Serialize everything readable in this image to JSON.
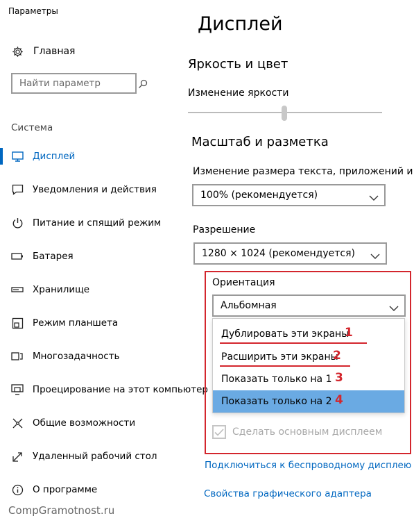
{
  "window": {
    "title": "Параметры"
  },
  "sidebar": {
    "home_label": "Главная",
    "search_placeholder": "Найти параметр",
    "group_label": "Система",
    "items": [
      {
        "label": "Дисплей",
        "icon": "monitor-icon",
        "active": true
      },
      {
        "label": "Уведомления и действия",
        "icon": "notification-icon",
        "active": false
      },
      {
        "label": "Питание и спящий режим",
        "icon": "power-icon",
        "active": false
      },
      {
        "label": "Батарея",
        "icon": "battery-icon",
        "active": false
      },
      {
        "label": "Хранилище",
        "icon": "storage-icon",
        "active": false
      },
      {
        "label": "Режим планшета",
        "icon": "tablet-mode-icon",
        "active": false
      },
      {
        "label": "Многозадачность",
        "icon": "multitasking-icon",
        "active": false
      },
      {
        "label": "Проецирование на этот компьютер",
        "icon": "projecting-icon",
        "active": false
      },
      {
        "label": "Общие возможности",
        "icon": "shared-experiences-icon",
        "active": false
      },
      {
        "label": "Удаленный рабочий стол",
        "icon": "remote-desktop-icon",
        "active": false
      },
      {
        "label": "О программе",
        "icon": "info-icon",
        "active": false
      }
    ]
  },
  "main": {
    "title": "Дисплей",
    "brightness": {
      "heading": "Яркость и цвет",
      "slider_label": "Изменение яркости",
      "slider_value_fraction": 0.5
    },
    "scale": {
      "heading": "Масштаб и разметка",
      "size_label": "Изменение размера текста, приложений и др",
      "size_value": "100% (рекомендуется)",
      "resolution_label": "Разрешение",
      "resolution_value": "1280 × 1024 (рекомендуется)",
      "orientation_label": "Ориентация",
      "orientation_value": "Альбомная"
    },
    "multi_display_options": [
      {
        "label": "Дублировать эти экраны",
        "number": "1"
      },
      {
        "label": "Расширить эти экраны",
        "number": "2"
      },
      {
        "label": "Показать только на 1",
        "number": "3"
      },
      {
        "label": "Показать только на 2",
        "number": "4",
        "selected": true
      }
    ],
    "make_main_display": {
      "label": "Сделать основным дисплеем",
      "checked": true,
      "disabled": true
    },
    "links": {
      "wireless": "Подключиться к беспроводному дисплею",
      "adapter": "Свойства графического адаптера"
    }
  },
  "watermark": "CompGramotnost.ru",
  "colors": {
    "accent": "#0067c0",
    "annotation_red": "#d3262d",
    "selected_option": "#6aaae3"
  }
}
